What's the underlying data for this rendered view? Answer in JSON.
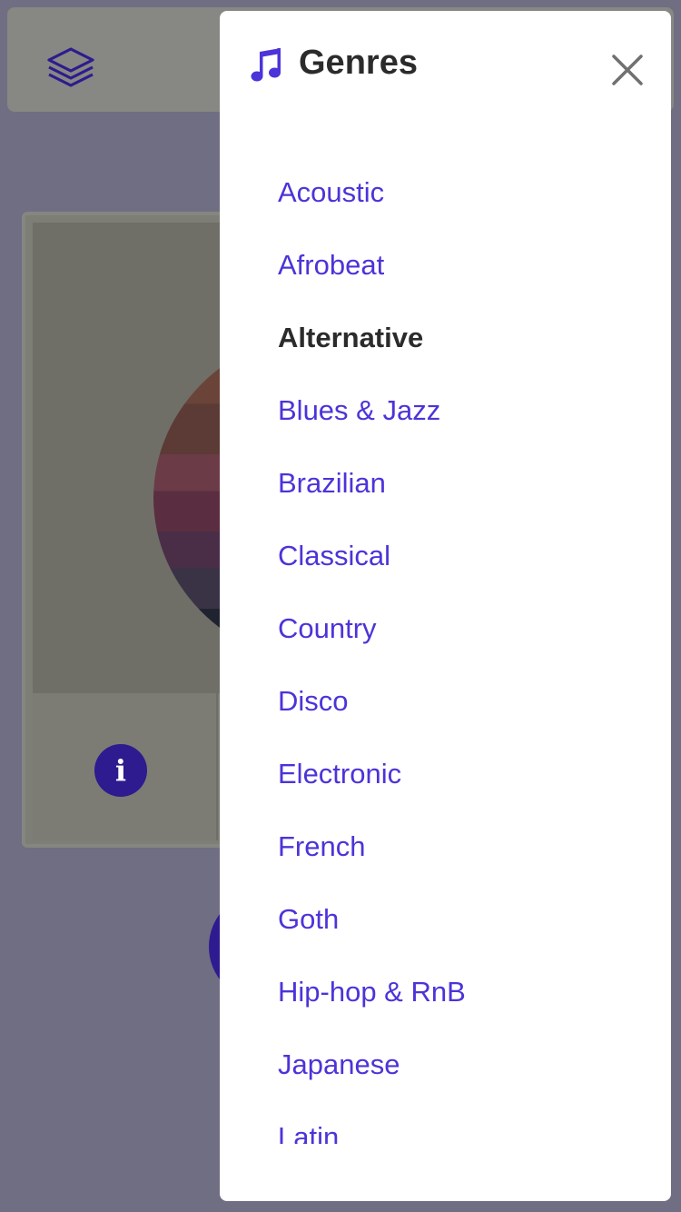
{
  "drawer": {
    "title": "Genres",
    "genres": [
      {
        "label": "Acoustic",
        "active": false
      },
      {
        "label": "Afrobeat",
        "active": false
      },
      {
        "label": "Alternative",
        "active": true
      },
      {
        "label": "Blues & Jazz",
        "active": false
      },
      {
        "label": "Brazilian",
        "active": false
      },
      {
        "label": "Classical",
        "active": false
      },
      {
        "label": "Country",
        "active": false
      },
      {
        "label": "Disco",
        "active": false
      },
      {
        "label": "Electronic",
        "active": false
      },
      {
        "label": "French",
        "active": false
      },
      {
        "label": "Goth",
        "active": false
      },
      {
        "label": "Hip-hop & RnB",
        "active": false
      },
      {
        "label": "Japanese",
        "active": false
      },
      {
        "label": "Latin",
        "active": false
      }
    ]
  },
  "icons": {
    "header_menu": "layers-icon",
    "title": "music-note-icon",
    "close": "close-icon",
    "info": "info-icon"
  },
  "colors": {
    "accent": "#4b34d9",
    "active_text": "#2b2b2b",
    "overlay": "#6f6e82",
    "primary_dark": "#2d1b8f"
  }
}
